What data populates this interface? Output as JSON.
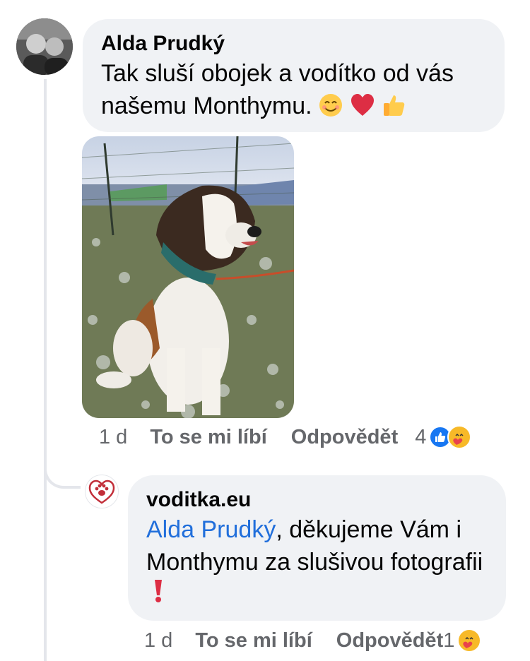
{
  "comment": {
    "author": "Alda Prudký",
    "text": "Tak sluší obojek a vodítko od vás našemu Monthymu.",
    "emojis": [
      "smiling-face-icon",
      "red-heart-icon",
      "thumbs-up-icon"
    ],
    "actions": {
      "time": "1 d",
      "like_label": "To se mi líbí",
      "reply_label": "Odpovědět",
      "reaction_count": "4",
      "reactions": [
        "like-icon",
        "care-icon"
      ]
    }
  },
  "reply": {
    "author": "voditka.eu",
    "mention": "Alda Prudký",
    "text": ", děkujeme Vám i Monthymu za slušivou fotografii",
    "emojis": [
      "red-exclamation-icon"
    ],
    "actions": {
      "time": "1 d",
      "like_label": "To se mi líbí",
      "reply_label": "Odpovědět",
      "reaction_count": "1",
      "reactions": [
        "care-icon"
      ]
    }
  },
  "colors": {
    "bubble": "#f0f2f5",
    "mention": "#216fdb",
    "meta": "#65676b",
    "like_blue": "#1877f2",
    "brand_red": "#c22f3a"
  }
}
